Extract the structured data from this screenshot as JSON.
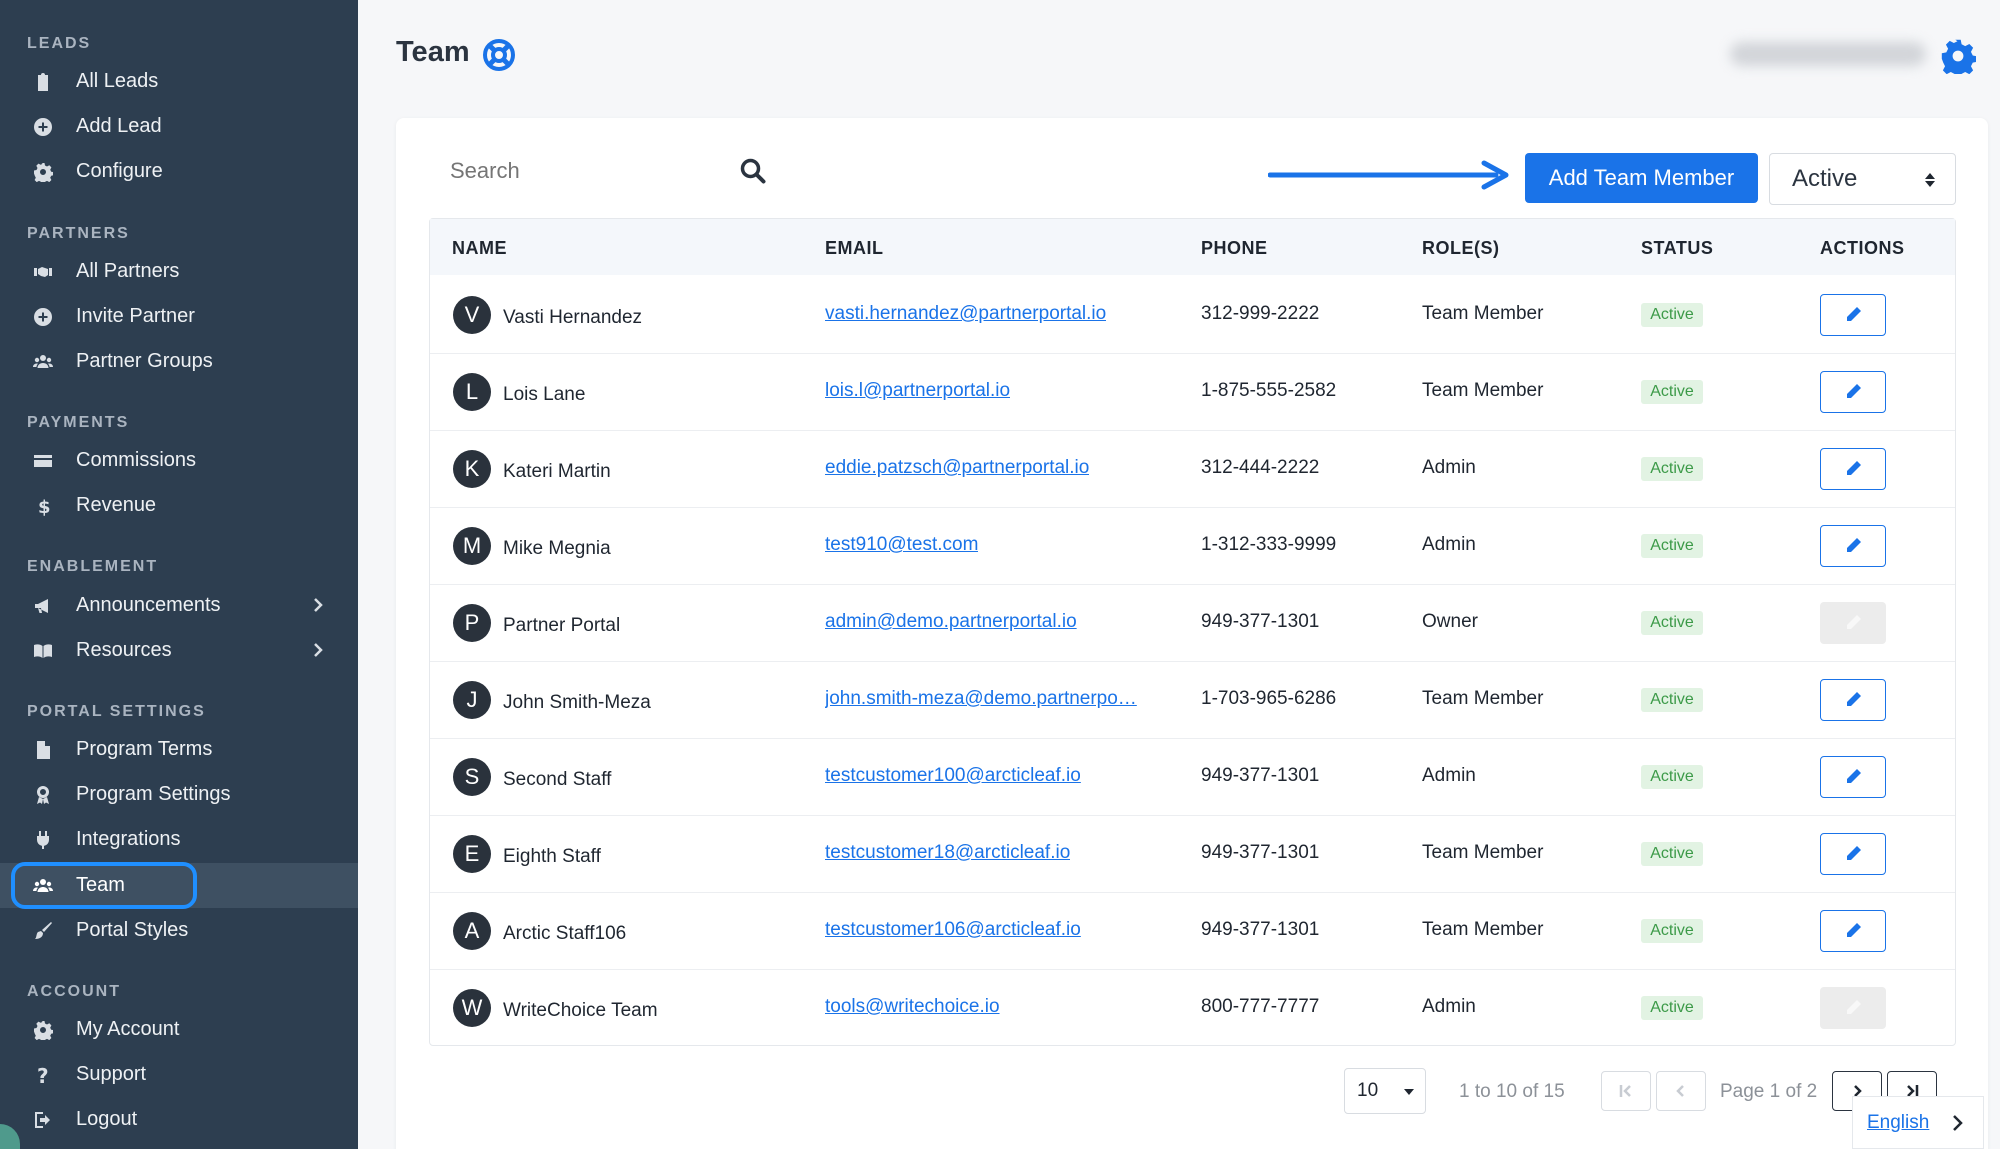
{
  "sidebar": {
    "sections": [
      {
        "title": "LEADS",
        "items": [
          {
            "label": "All Leads",
            "icon": "clipboard-icon"
          },
          {
            "label": "Add Lead",
            "icon": "plus-circle-icon"
          },
          {
            "label": "Configure",
            "icon": "gear-icon"
          }
        ]
      },
      {
        "title": "PARTNERS",
        "items": [
          {
            "label": "All Partners",
            "icon": "handshake-icon"
          },
          {
            "label": "Invite Partner",
            "icon": "plus-circle-icon"
          },
          {
            "label": "Partner Groups",
            "icon": "users-icon"
          }
        ]
      },
      {
        "title": "PAYMENTS",
        "items": [
          {
            "label": "Commissions",
            "icon": "credit-card-icon"
          },
          {
            "label": "Revenue",
            "icon": "dollar-icon"
          }
        ]
      },
      {
        "title": "ENABLEMENT",
        "items": [
          {
            "label": "Announcements",
            "icon": "megaphone-icon"
          },
          {
            "label": "Resources",
            "icon": "book-icon"
          }
        ]
      },
      {
        "title": "PORTAL SETTINGS",
        "items": [
          {
            "label": "Program Terms",
            "icon": "file-icon"
          },
          {
            "label": "Program Settings",
            "icon": "award-icon"
          },
          {
            "label": "Integrations",
            "icon": "plug-icon"
          },
          {
            "label": "Team",
            "icon": "users-icon"
          },
          {
            "label": "Portal Styles",
            "icon": "paintbrush-icon"
          }
        ]
      },
      {
        "title": "ACCOUNT",
        "items": [
          {
            "label": "My Account",
            "icon": "gear-icon"
          },
          {
            "label": "Support",
            "icon": "question-icon"
          },
          {
            "label": "Logout",
            "icon": "logout-icon"
          }
        ]
      }
    ],
    "active_item": "Team"
  },
  "header": {
    "title": "Team"
  },
  "toolbar": {
    "search_placeholder": "Search",
    "add_button": "Add Team Member",
    "status_filter": "Active"
  },
  "table": {
    "columns": [
      "NAME",
      "EMAIL",
      "PHONE",
      "ROLE(S)",
      "STATUS",
      "ACTIONS"
    ],
    "rows": [
      {
        "initial": "V",
        "name": "Vasti Hernandez",
        "email": "vasti.hernandez@partnerportal.io",
        "phone": "312-999-2222",
        "role": "Team Member",
        "status": "Active",
        "editable": true
      },
      {
        "initial": "L",
        "name": "Lois Lane",
        "email": "lois.l@partnerportal.io",
        "phone": "1-875-555-2582",
        "role": "Team Member",
        "status": "Active",
        "editable": true
      },
      {
        "initial": "K",
        "name": "Kateri Martin",
        "email": "eddie.patzsch@partnerportal.io",
        "phone": "312-444-2222",
        "role": "Admin",
        "status": "Active",
        "editable": true
      },
      {
        "initial": "M",
        "name": "Mike Megnia",
        "email": "test910@test.com",
        "phone": "1-312-333-9999",
        "role": "Admin",
        "status": "Active",
        "editable": true
      },
      {
        "initial": "P",
        "name": "Partner Portal",
        "email": "admin@demo.partnerportal.io",
        "phone": "949-377-1301",
        "role": "Owner",
        "status": "Active",
        "editable": false
      },
      {
        "initial": "J",
        "name": "John Smith-Meza",
        "email": "john.smith-meza@demo.partnerpo…",
        "phone": "1-703-965-6286",
        "role": "Team Member",
        "status": "Active",
        "editable": true
      },
      {
        "initial": "S",
        "name": "Second Staff",
        "email": "testcustomer100@arcticleaf.io",
        "phone": "949-377-1301",
        "role": "Admin",
        "status": "Active",
        "editable": true
      },
      {
        "initial": "E",
        "name": "Eighth Staff",
        "email": "testcustomer18@arcticleaf.io",
        "phone": "949-377-1301",
        "role": "Team Member",
        "status": "Active",
        "editable": true
      },
      {
        "initial": "A",
        "name": "Arctic Staff106",
        "email": "testcustomer106@arcticleaf.io",
        "phone": "949-377-1301",
        "role": "Team Member",
        "status": "Active",
        "editable": true
      },
      {
        "initial": "W",
        "name": "WriteChoice Team",
        "email": "tools@writechoice.io",
        "phone": "800-777-7777",
        "role": "Admin",
        "status": "Active",
        "editable": false
      }
    ]
  },
  "pagination": {
    "page_size": "10",
    "range": "1 to 10 of 15",
    "page_label": "Page 1 of 2"
  },
  "language": "English",
  "colors": {
    "sidebar_bg": "#2d3e50",
    "accent": "#1a73e8",
    "active_badge_bg": "#e2f3e3",
    "active_badge_text": "#3c9a48"
  }
}
